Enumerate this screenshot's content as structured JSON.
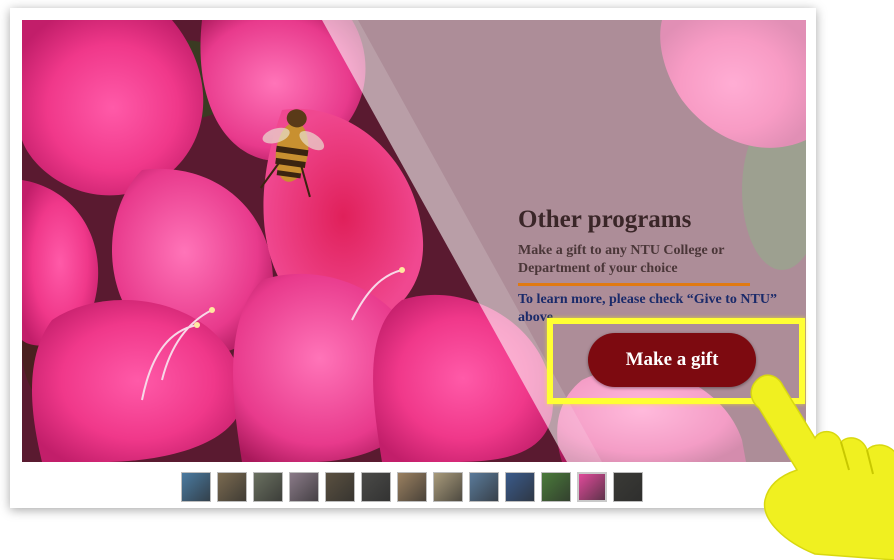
{
  "panel": {
    "title": "Other programs",
    "description": "Make a gift to any NTU College or Department of your choice",
    "more_info": "To learn more, please check “Give to NTU” above",
    "cta_label": "Make a gift"
  },
  "colors": {
    "cta_background": "#7d0a10",
    "accent_rule": "#e07a12",
    "highlight_box": "#ffff33",
    "pointer_hand": "#f0f020"
  },
  "thumbnails": [
    {
      "color": "#4a7aa0",
      "active": false
    },
    {
      "color": "#7a6a50",
      "active": false
    },
    {
      "color": "#6a7060",
      "active": false
    },
    {
      "color": "#8a7a88",
      "active": false
    },
    {
      "color": "#5a5040",
      "active": false
    },
    {
      "color": "#4a4a48",
      "active": false
    },
    {
      "color": "#9a8060",
      "active": false
    },
    {
      "color": "#a89a7a",
      "active": false
    },
    {
      "color": "#5a7a9a",
      "active": false
    },
    {
      "color": "#3a5a8a",
      "active": false
    },
    {
      "color": "#4a7a3a",
      "active": false
    },
    {
      "color": "#e04a9a",
      "active": true
    },
    {
      "color": "#3a3a36",
      "active": false
    }
  ],
  "icons": {
    "pointer": "pointing-hand-icon",
    "photo_subject": "bee-on-azalea-photo"
  }
}
